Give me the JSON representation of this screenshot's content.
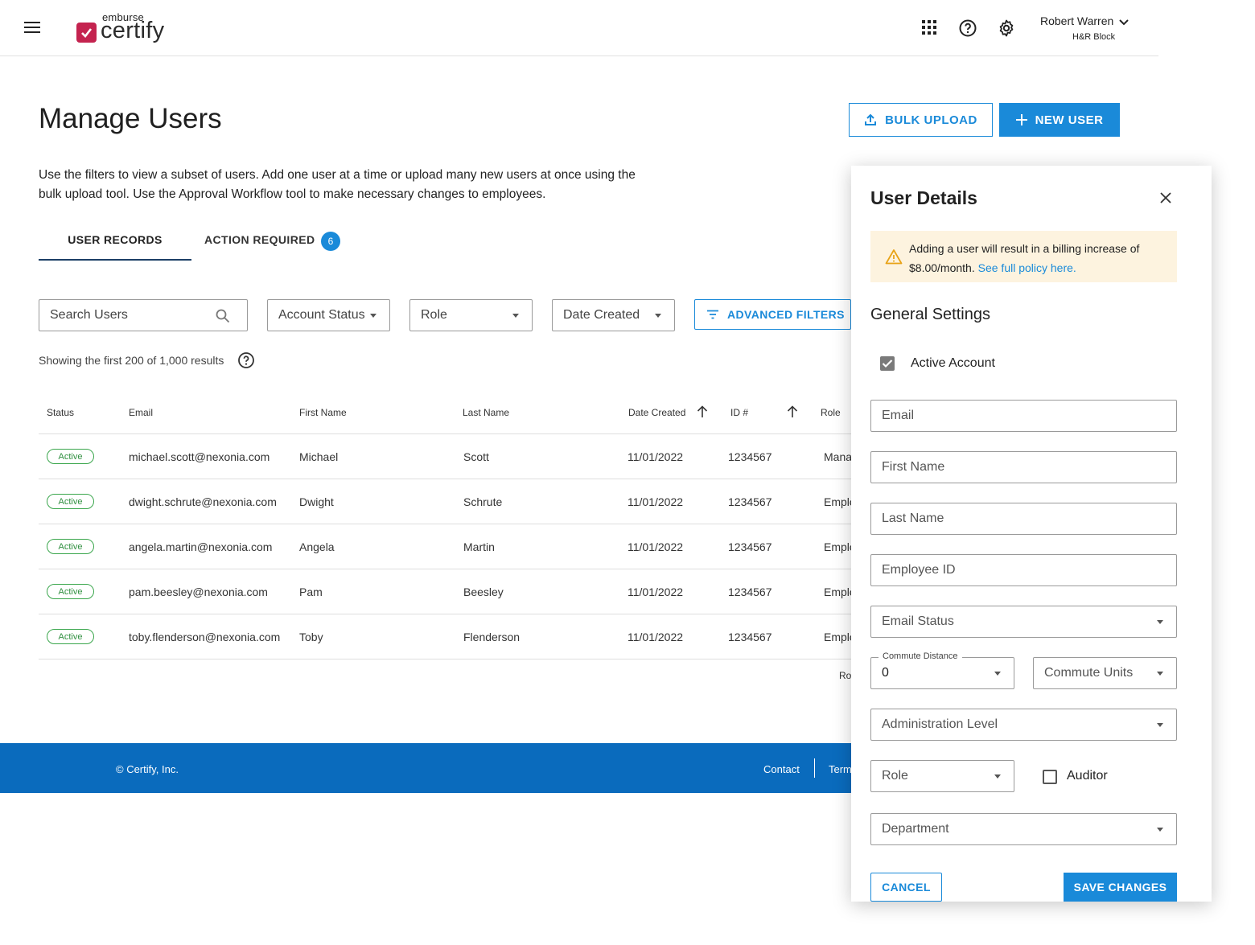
{
  "header": {
    "brand_small": "emburse",
    "brand_big": "certify",
    "user_name": "Robert Warren",
    "user_org": "H&R Block",
    "icons": [
      "menu-icon",
      "apps-grid-icon",
      "help-icon",
      "settings-gear-icon",
      "chevron-down-icon"
    ]
  },
  "page": {
    "title": "Manage Users",
    "bulk_upload_label": "BULK UPLOAD",
    "new_user_label": "NEW USER",
    "description": "Use the filters to view a subset of users. Add one user at a time or upload many new users at once using the bulk upload tool. Use the Approval Workflow tool to make necessary changes to employees."
  },
  "tabs": {
    "records_label": "USER RECORDS",
    "action_label": "ACTION REQUIRED",
    "action_count": "6"
  },
  "filters": {
    "search_placeholder": "Search Users",
    "account_status": "Account Status",
    "role": "Role",
    "date_created": "Date Created",
    "advanced": "ADVANCED FILTERS"
  },
  "results_text": "Showing the first 200 of 1,000 results",
  "table": {
    "headers": {
      "status": "Status",
      "email": "Email",
      "first": "First Name",
      "last": "Last Name",
      "date": "Date Created",
      "id": "ID #",
      "role": "Role"
    },
    "rows": [
      {
        "status": "Active",
        "email": "michael.scott@nexonia.com",
        "first": "Michael",
        "last": "Scott",
        "date": "11/01/2022",
        "id": "1234567",
        "role": "Mana"
      },
      {
        "status": "Active",
        "email": "dwight.schrute@nexonia.com",
        "first": "Dwight",
        "last": "Schrute",
        "date": "11/01/2022",
        "id": "1234567",
        "role": "Emplo"
      },
      {
        "status": "Active",
        "email": "angela.martin@nexonia.com",
        "first": "Angela",
        "last": "Martin",
        "date": "11/01/2022",
        "id": "1234567",
        "role": "Emplo"
      },
      {
        "status": "Active",
        "email": "pam.beesley@nexonia.com",
        "first": "Pam",
        "last": "Beesley",
        "date": "11/01/2022",
        "id": "1234567",
        "role": "Emplo"
      },
      {
        "status": "Active",
        "email": "toby.flenderson@nexonia.com",
        "first": "Toby",
        "last": "Flenderson",
        "date": "11/01/2022",
        "id": "1234567",
        "role": "Emplo"
      }
    ],
    "rows_per_page_label": "Ro"
  },
  "footer": {
    "copyright": "© Certify, Inc.",
    "contact": "Contact",
    "terms": "Term"
  },
  "panel": {
    "title": "User Details",
    "alert_text": "Adding a user will result in a billing increase of $8.00/month.",
    "alert_link": "See full policy here.",
    "section": "General Settings",
    "active_account": "Active Account",
    "active_checked": true,
    "email": "Email",
    "first_name": "First Name",
    "last_name": "Last Name",
    "employee_id": "Employee ID",
    "email_status": "Email Status",
    "commute_distance_label": "Commute Distance",
    "commute_distance_value": "0",
    "commute_units": "Commute Units",
    "admin_level": "Administration Level",
    "role": "Role",
    "auditor": "Auditor",
    "auditor_checked": false,
    "department": "Department",
    "cancel": "CANCEL",
    "save": "SAVE CHANGES"
  },
  "colors": {
    "primary": "#1a8ad9",
    "footer": "#0a6bbd",
    "brand": "#c4234f",
    "active_badge": "#3aa64c",
    "alert_bg": "#fdf3df",
    "warning": "#e8a317"
  }
}
